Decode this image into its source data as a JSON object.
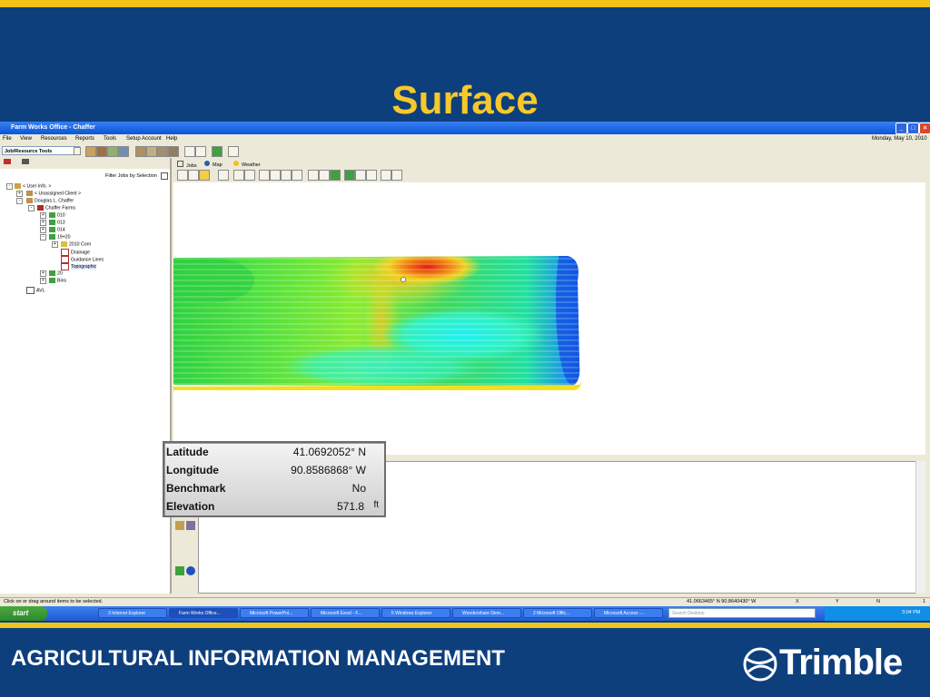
{
  "slide": {
    "title": "Surface",
    "footer": "AGRICULTURAL INFORMATION MANAGEMENT",
    "logo": "Trimble"
  },
  "window": {
    "title": "Farm Works Office - Chaffer",
    "date": "Monday, May 10, 2010",
    "menu": [
      "File",
      "View",
      "Resources",
      "Reports",
      "Tools",
      "Setup Account",
      "Help"
    ],
    "resource_select": "Job/Resource Tools",
    "filter_label": "Filter Jobs by Selection",
    "tabs": [
      "Jobs",
      "Map",
      "Weather"
    ],
    "status_text": "Click on or drag around items to be selected.",
    "coords": "41.0663465° N  90.8640430° W",
    "coord_x": "X",
    "coord_y": "Y",
    "coord_n": "N",
    "coord_val": "1"
  },
  "tree": [
    "< User Info. >",
    "< Unassigned Client >",
    "Douglas L. Chaffer",
    "Chaffer Farms",
    "010",
    "013",
    "014",
    "19+20",
    "2010 Corn",
    "Drainage",
    "Guidance Lines",
    "Topographic",
    "20",
    "Bins",
    "AVL"
  ],
  "info_popup": {
    "rows": [
      {
        "label": "Latitude",
        "value": "41.0692052° N",
        "unit": ""
      },
      {
        "label": "Longitude",
        "value": "90.8586868° W",
        "unit": ""
      },
      {
        "label": "Benchmark",
        "value": "No",
        "unit": ""
      },
      {
        "label": "Elevation",
        "value": "571.8",
        "unit": "ft"
      }
    ]
  },
  "taskbar": {
    "start": "start",
    "tasks": [
      "3 Internet Explorer",
      "Farm Works Office...",
      "Microsoft PowerPoi...",
      "Microsoft Excel - F...",
      "5 Windows Explorer",
      "Wondershare Dem...",
      "2 Microsoft Offic...",
      "Microsoft Access -..."
    ],
    "search": "Search Desktop",
    "clock": "3:04 PM"
  }
}
